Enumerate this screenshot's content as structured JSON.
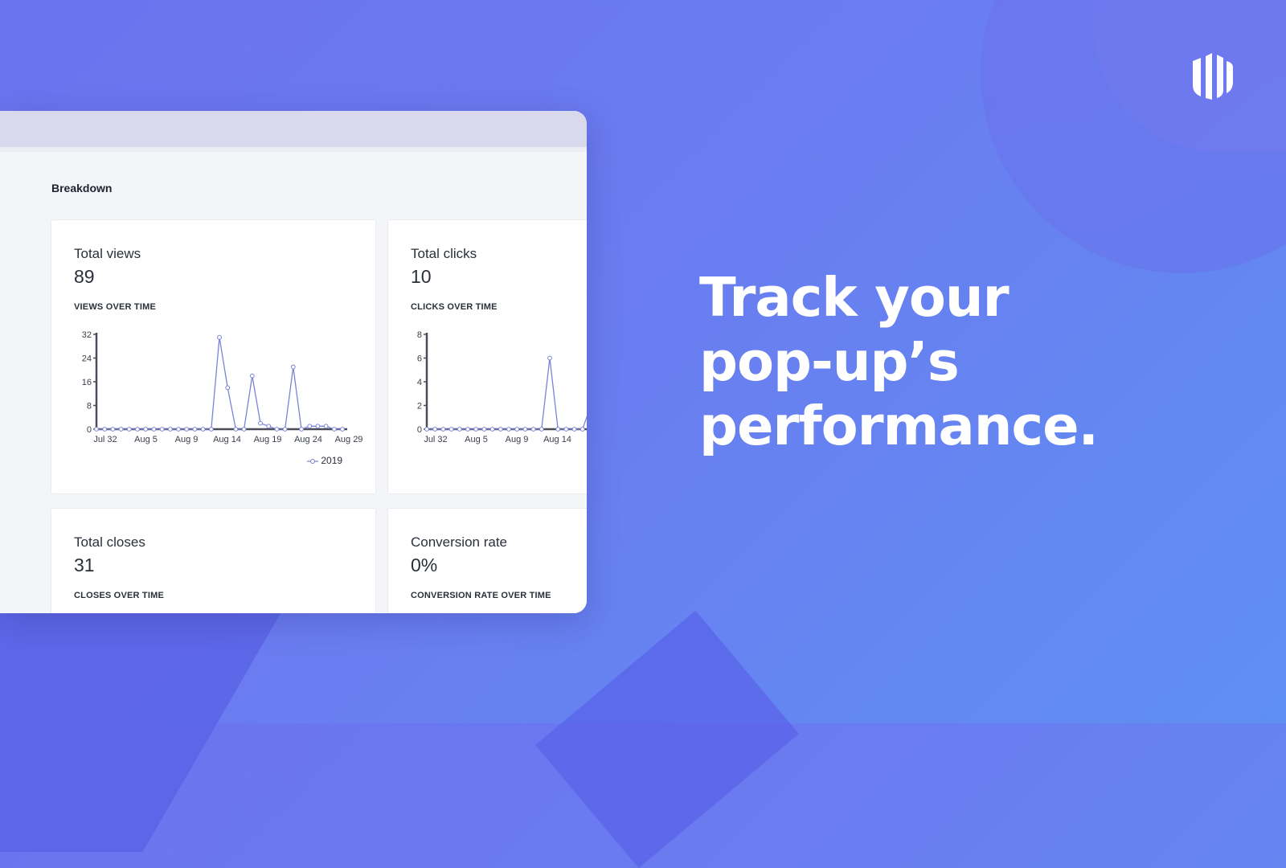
{
  "headline": {
    "line1": "Track your",
    "line2": "pop-up’s",
    "line3": "performance."
  },
  "logo": {
    "icon": "brand-logo-icon"
  },
  "dashboard": {
    "section_title": "Breakdown",
    "cards": [
      {
        "title": "Total views",
        "value": "89",
        "subtitle": "VIEWS OVER TIME"
      },
      {
        "title": "Total clicks",
        "value": "10",
        "subtitle": "CLICKS OVER TIME"
      },
      {
        "title": "Total closes",
        "value": "31",
        "subtitle": "CLOSES OVER TIME"
      },
      {
        "title": "Conversion rate",
        "value": "0%",
        "subtitle": "CONVERSION RATE OVER TIME"
      }
    ]
  },
  "chart_data": [
    {
      "type": "line",
      "x_ticks": [
        "Jul 32",
        "Aug 5",
        "Aug 9",
        "Aug 14",
        "Aug 19",
        "Aug 24",
        "Aug 29"
      ],
      "y_ticks": [
        0,
        8,
        16,
        24,
        32
      ],
      "ylim": [
        0,
        32
      ],
      "series": [
        {
          "name": "2019",
          "color": "#7b83d6",
          "values": [
            0,
            0,
            0,
            0,
            0,
            0,
            0,
            0,
            0,
            0,
            0,
            0,
            0,
            0,
            0,
            31,
            14,
            0,
            0,
            18,
            2,
            1,
            0,
            0,
            21,
            0,
            1,
            1,
            1,
            0,
            0
          ]
        }
      ],
      "legend": "bottom-right"
    },
    {
      "type": "line",
      "x_ticks": [
        "Jul 32",
        "Aug 5",
        "Aug 9",
        "Aug 14",
        "Au"
      ],
      "y_ticks": [
        0,
        2,
        4,
        6,
        8
      ],
      "ylim": [
        0,
        8
      ],
      "series": [
        {
          "color": "#7b83d6",
          "values": [
            0,
            0,
            0,
            0,
            0,
            0,
            0,
            0,
            0,
            0,
            0,
            0,
            0,
            0,
            0,
            6,
            0,
            0,
            0,
            0,
            2
          ]
        }
      ]
    }
  ]
}
